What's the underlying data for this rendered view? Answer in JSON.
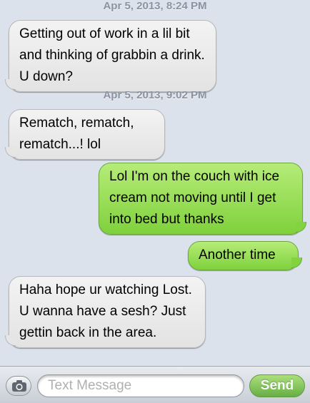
{
  "thread": {
    "timestamps": [
      "Apr 5, 2013, 8:24 PM",
      "Apr 5, 2013, 9:02 PM"
    ],
    "messages": [
      {
        "direction": "incoming",
        "text": "Getting out of work in a lil bit and thinking of grabbin a drink. U down?"
      },
      {
        "direction": "incoming",
        "text": "Rematch, rematch, rematch...! lol"
      },
      {
        "direction": "outgoing",
        "text": "Lol I'm on the couch with ice cream not moving until I get into bed but thanks"
      },
      {
        "direction": "outgoing",
        "text": "Another time"
      },
      {
        "direction": "incoming",
        "text": "Haha hope ur watching Lost. U wanna have a sesh? Just gettin back in the area."
      }
    ]
  },
  "composer": {
    "camera_icon": "camera-icon",
    "placeholder": "Text Message",
    "value": "",
    "send_label": "Send"
  },
  "colors": {
    "background": "#dbe2ec",
    "incoming_bubble": "#e5e5e5",
    "outgoing_bubble": "#82d33f",
    "timestamp": "#8a93a1"
  }
}
